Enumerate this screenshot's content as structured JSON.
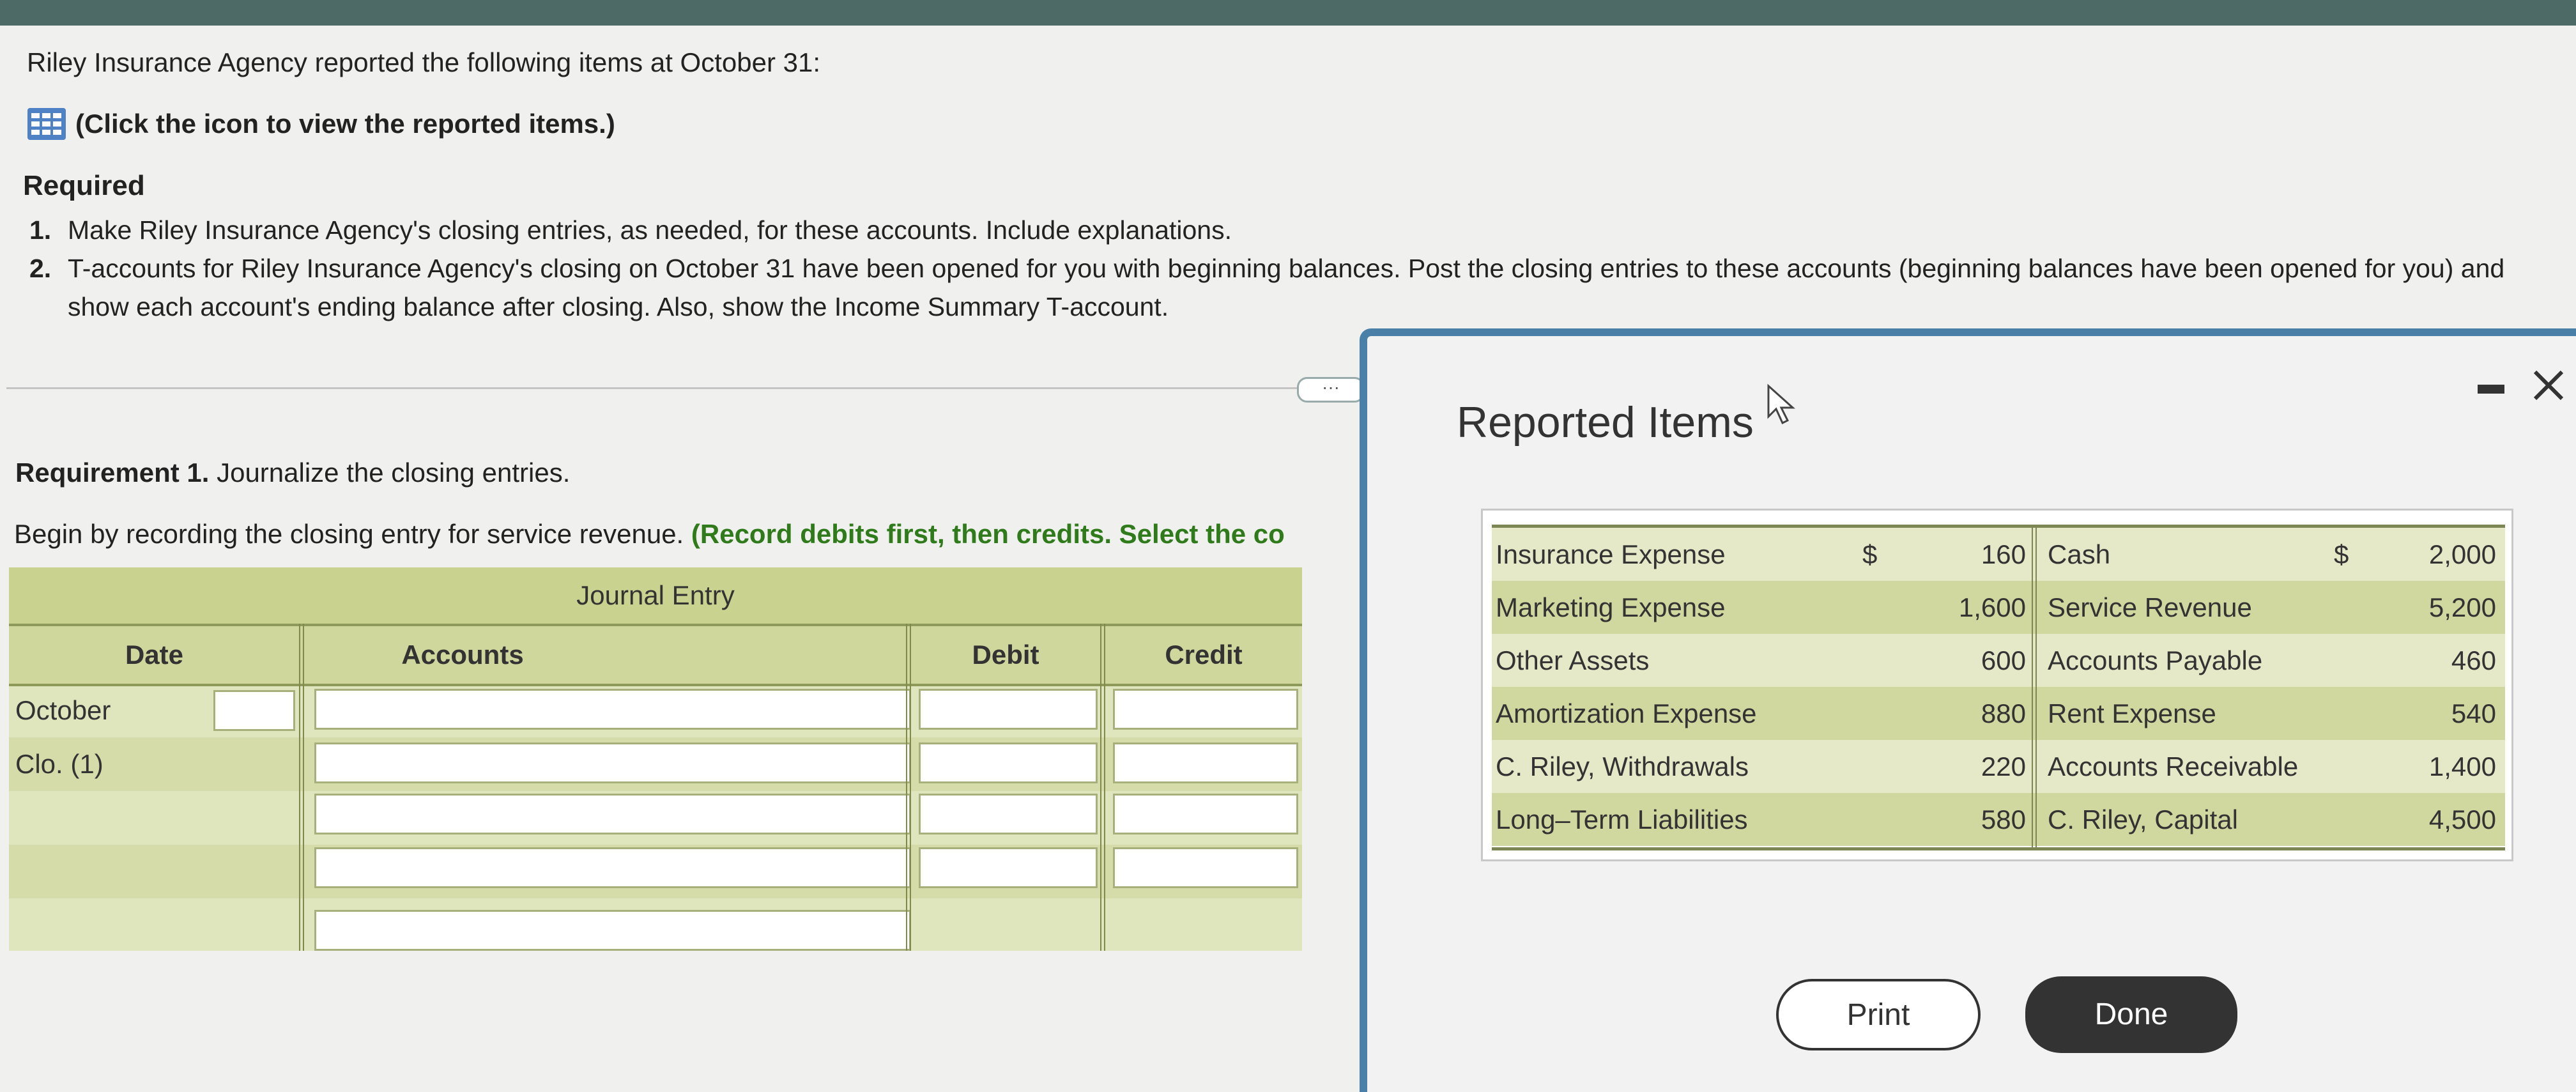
{
  "intro": "Riley Insurance Agency reported the following items at October 31:",
  "icon_link": "(Click the icon to view the reported items.)",
  "required_title": "Required",
  "required_items": [
    {
      "num": "1.",
      "text": "Make Riley Insurance Agency's closing entries, as needed, for these accounts. Include explanations."
    },
    {
      "num": "2.",
      "text": "T-accounts for Riley Insurance Agency's closing on October 31 have been opened for you with beginning balances. Post the closing entries to these accounts (beginning balances have been opened for you) and show each account's ending balance after closing. Also, show the Income Summary T-account."
    }
  ],
  "more": "···",
  "req1": {
    "bold": "Requirement 1.",
    "text": " Journalize the closing entries."
  },
  "begin": {
    "text": "Begin by recording the closing entry for service revenue. ",
    "green": "(Record debits first, then credits. Select the co"
  },
  "journal": {
    "title": "Journal Entry",
    "cols": {
      "date": "Date",
      "accounts": "Accounts",
      "debit": "Debit",
      "credit": "Credit"
    },
    "row_labels": [
      "October",
      "Clo. (1)"
    ]
  },
  "modal": {
    "title": "Reported Items",
    "items": [
      {
        "left": "Insurance Expense",
        "lcur": "$",
        "lval": "160",
        "right": "Cash",
        "rcur": "$",
        "rval": "2,000"
      },
      {
        "left": "Marketing Expense",
        "lcur": "",
        "lval": "1,600",
        "right": "Service Revenue",
        "rcur": "",
        "rval": "5,200"
      },
      {
        "left": "Other Assets",
        "lcur": "",
        "lval": "600",
        "right": "Accounts Payable",
        "rcur": "",
        "rval": "460"
      },
      {
        "left": "Amortization Expense",
        "lcur": "",
        "lval": "880",
        "right": "Rent Expense",
        "rcur": "",
        "rval": "540"
      },
      {
        "left": "C. Riley, Withdrawals",
        "lcur": "",
        "lval": "220",
        "right": "Accounts Receivable",
        "rcur": "",
        "rval": "1,400"
      },
      {
        "left": "Long–Term Liabilities",
        "lcur": "",
        "lval": "580",
        "right": "C. Riley, Capital",
        "rcur": "",
        "rval": "4,500"
      }
    ],
    "print": "Print",
    "done": "Done"
  },
  "colors": {
    "accent": "#4a7fa8",
    "table_header": "#c9d28f",
    "row_alt": "#d0d79f",
    "green_text": "#2f7a1a"
  }
}
